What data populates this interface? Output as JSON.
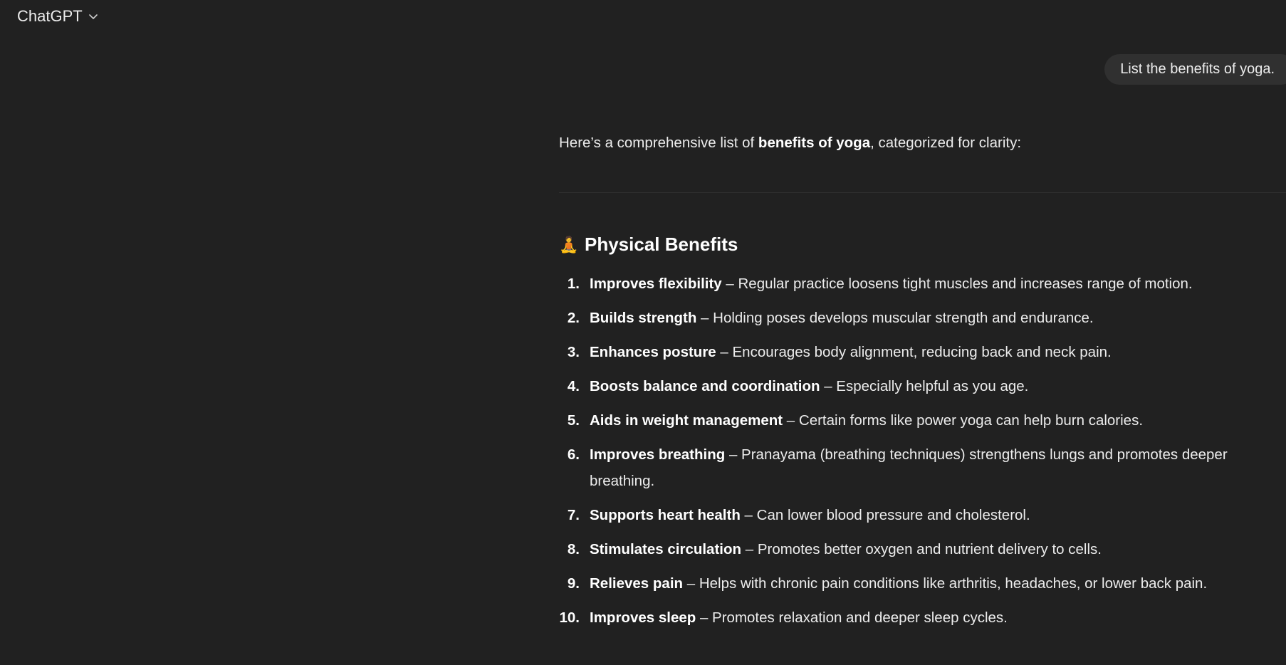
{
  "header": {
    "model_name": "ChatGPT",
    "dropdown_icon": "chevron-down-icon"
  },
  "user_message": "List the benefits of yoga.",
  "assistant": {
    "intro_prefix": "Here’s a comprehensive list of ",
    "intro_bold": "benefits of yoga",
    "intro_suffix": ", categorized for clarity:",
    "section": {
      "emoji": "🧘",
      "title": "Physical Benefits"
    },
    "items": [
      {
        "num": "1.",
        "title": "Improves flexibility",
        "desc": " – Regular practice loosens tight muscles and increases range of motion."
      },
      {
        "num": "2.",
        "title": "Builds strength",
        "desc": " – Holding poses develops muscular strength and endurance."
      },
      {
        "num": "3.",
        "title": "Enhances posture",
        "desc": " – Encourages body alignment, reducing back and neck pain."
      },
      {
        "num": "4.",
        "title": "Boosts balance and coordination",
        "desc": " – Especially helpful as you age."
      },
      {
        "num": "5.",
        "title": "Aids in weight management",
        "desc": " – Certain forms like power yoga can help burn calories."
      },
      {
        "num": "6.",
        "title": "Improves breathing",
        "desc": " – Pranayama (breathing techniques) strengthens lungs and promotes deeper breathing."
      },
      {
        "num": "7.",
        "title": "Supports heart health",
        "desc": " – Can lower blood pressure and cholesterol."
      },
      {
        "num": "8.",
        "title": "Stimulates circulation",
        "desc": " – Promotes better oxygen and nutrient delivery to cells."
      },
      {
        "num": "9.",
        "title": "Relieves pain",
        "desc": " – Helps with chronic pain conditions like arthritis, headaches, or lower back pain."
      },
      {
        "num": "10.",
        "title": "Improves sleep",
        "desc": " – Promotes relaxation and deeper sleep cycles."
      }
    ]
  },
  "colors": {
    "background": "#212121",
    "bubble": "#303030",
    "text": "#ececec"
  }
}
